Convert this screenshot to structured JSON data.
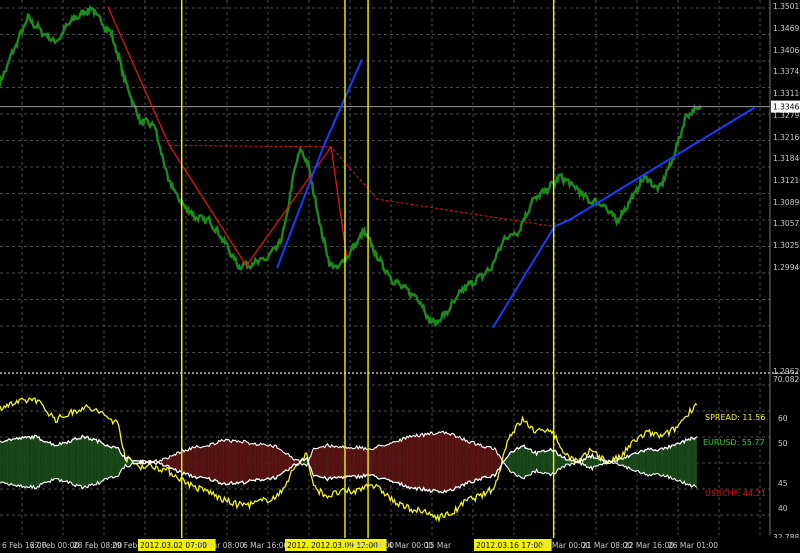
{
  "colors": {
    "background": "#000000",
    "grid": "#4a4a4a",
    "price": "#1d8a1d",
    "red_line": "#e01414",
    "blue_line": "#1a3cff",
    "yellow_marker": "#f4f400",
    "spread": "#f2f22a",
    "eurusd": "#ffffff",
    "green_fill": "#1a4a1a",
    "red_fill": "#5a1414",
    "label_text": "#c8c8c8",
    "separator": "#8a8a8a"
  },
  "chart_data": [
    {
      "type": "line",
      "name": "EURUSD price",
      "ylim": [
        1.2962,
        1.35015
      ],
      "y_ticks": [
        "1.35015",
        "1.34695",
        "1.34060",
        "1.33745",
        "1.33110",
        "1.32795",
        "1.32160",
        "1.31840",
        "1.31210",
        "1.30890",
        "1.30575",
        "1.30255",
        "1.29940",
        "1.29620"
      ],
      "current_price_label": "1.33465",
      "current_price": 1.33465,
      "x_labels": [
        "6 Feb 16:00",
        "27 Feb 00:00",
        "28 Feb 08:00",
        "29 Feb 16:00",
        "2012.03.02 07:00",
        "5 Mar 08:00",
        "6 Mar 16:00",
        "2012.03.08",
        "2012.03.09 12:00",
        "12 Mar 16:00",
        "14 Mar 00:00",
        "15 Mar",
        "2012.03.16 17:00",
        "20 Mar 00:00",
        "21 Mar 08:00",
        "22 Mar 16:00",
        "26 Mar 01:00"
      ],
      "x_highlighted_labels": [
        "2012.03.02 07:00",
        "2012.03.08",
        "2012.03.09 12:00",
        "2012.03.16 17:00"
      ],
      "price_anchors": [
        [
          0,
          1.338
        ],
        [
          0.02,
          1.343
        ],
        [
          0.04,
          1.3475
        ],
        [
          0.06,
          1.3455
        ],
        [
          0.08,
          1.344
        ],
        [
          0.1,
          1.347
        ],
        [
          0.13,
          1.349
        ],
        [
          0.16,
          1.345
        ],
        [
          0.18,
          1.338
        ],
        [
          0.2,
          1.3325
        ],
        [
          0.22,
          1.332
        ],
        [
          0.24,
          1.324
        ],
        [
          0.26,
          1.3205
        ],
        [
          0.28,
          1.3185
        ],
        [
          0.3,
          1.318
        ],
        [
          0.32,
          1.315
        ],
        [
          0.34,
          1.3115
        ],
        [
          0.36,
          1.3118
        ],
        [
          0.38,
          1.3125
        ],
        [
          0.4,
          1.3148
        ],
        [
          0.41,
          1.319
        ],
        [
          0.42,
          1.3255
        ],
        [
          0.43,
          1.3285
        ],
        [
          0.44,
          1.326
        ],
        [
          0.45,
          1.321
        ],
        [
          0.46,
          1.316
        ],
        [
          0.47,
          1.312
        ],
        [
          0.48,
          1.311
        ],
        [
          0.5,
          1.3135
        ],
        [
          0.52,
          1.3165
        ],
        [
          0.54,
          1.3125
        ],
        [
          0.56,
          1.3095
        ],
        [
          0.58,
          1.308
        ],
        [
          0.6,
          1.3065
        ],
        [
          0.61,
          1.304
        ],
        [
          0.62,
          1.303
        ],
        [
          0.64,
          1.305
        ],
        [
          0.66,
          1.308
        ],
        [
          0.68,
          1.3095
        ],
        [
          0.7,
          1.311
        ],
        [
          0.72,
          1.3155
        ],
        [
          0.74,
          1.3165
        ],
        [
          0.76,
          1.321
        ],
        [
          0.78,
          1.3225
        ],
        [
          0.8,
          1.3245
        ],
        [
          0.82,
          1.323
        ],
        [
          0.84,
          1.321
        ],
        [
          0.86,
          1.3205
        ],
        [
          0.88,
          1.318
        ],
        [
          0.9,
          1.321
        ],
        [
          0.92,
          1.3245
        ],
        [
          0.94,
          1.3225
        ],
        [
          0.96,
          1.327
        ],
        [
          0.98,
          1.3335
        ],
        [
          1.0,
          1.3345
        ]
      ],
      "zigzag_red": [
        [
          0.14,
          1.3492
        ],
        [
          0.22,
          1.329
        ],
        [
          0.32,
          1.3115
        ],
        [
          0.43,
          1.3288
        ],
        [
          0.45,
          1.313
        ]
      ],
      "zigzag_red_dashed": [
        [
          0.22,
          1.329
        ],
        [
          0.43,
          1.3288
        ],
        [
          0.49,
          1.3212
        ],
        [
          0.72,
          1.3172
        ]
      ],
      "blue_lines": [
        [
          [
            0.36,
            1.3112
          ],
          [
            0.42,
            1.3288
          ],
          [
            0.47,
            1.3415
          ]
        ],
        [
          [
            0.64,
            1.3025
          ],
          [
            0.72,
            1.3172
          ],
          [
            0.74,
            1.3182
          ],
          [
            0.98,
            1.3345
          ]
        ]
      ],
      "vertical_markers_fraction": [
        0.236,
        0.448,
        0.478,
        0.719
      ]
    },
    {
      "type": "area",
      "name": "Spread oscillator",
      "ylim": [
        32.7883,
        70.0828
      ],
      "y_ticks": [
        "70.0828",
        "60",
        "50",
        "45",
        "40",
        "32.7883"
      ],
      "legend": [
        {
          "name": "SPREAD: 11.56",
          "color": "#f2f22a"
        },
        {
          "name": "EURUSD: 55.77",
          "color": "#2ad02a"
        },
        {
          "name": "USDCHF: 44.21",
          "color": "#e01414"
        }
      ],
      "spread_anchors": [
        [
          0,
          63
        ],
        [
          0.05,
          65
        ],
        [
          0.08,
          60
        ],
        [
          0.12,
          63
        ],
        [
          0.14,
          62
        ],
        [
          0.17,
          59
        ],
        [
          0.18,
          51
        ],
        [
          0.2,
          49
        ],
        [
          0.22,
          49
        ],
        [
          0.24,
          48
        ],
        [
          0.26,
          46
        ],
        [
          0.28,
          44
        ],
        [
          0.3,
          43
        ],
        [
          0.32,
          41
        ],
        [
          0.34,
          40
        ],
        [
          0.36,
          40
        ],
        [
          0.38,
          41
        ],
        [
          0.4,
          42
        ],
        [
          0.42,
          48
        ],
        [
          0.44,
          52
        ],
        [
          0.45,
          44
        ],
        [
          0.47,
          42
        ],
        [
          0.49,
          43
        ],
        [
          0.51,
          43
        ],
        [
          0.53,
          45
        ],
        [
          0.55,
          43
        ],
        [
          0.57,
          40
        ],
        [
          0.59,
          39
        ],
        [
          0.61,
          38
        ],
        [
          0.63,
          37
        ],
        [
          0.65,
          38
        ],
        [
          0.67,
          41
        ],
        [
          0.69,
          42
        ],
        [
          0.71,
          44
        ],
        [
          0.73,
          56
        ],
        [
          0.75,
          60
        ],
        [
          0.77,
          57
        ],
        [
          0.79,
          58
        ],
        [
          0.81,
          52
        ],
        [
          0.83,
          50
        ],
        [
          0.85,
          53
        ],
        [
          0.87,
          50
        ],
        [
          0.89,
          51
        ],
        [
          0.91,
          55
        ],
        [
          0.93,
          57
        ],
        [
          0.95,
          56
        ],
        [
          0.97,
          58
        ],
        [
          0.99,
          62
        ],
        [
          1.0,
          64
        ]
      ],
      "eurusd_anchors": [
        [
          0,
          55
        ],
        [
          0.05,
          56
        ],
        [
          0.08,
          54
        ],
        [
          0.12,
          56
        ],
        [
          0.14,
          55
        ],
        [
          0.17,
          53
        ],
        [
          0.18,
          51
        ],
        [
          0.2,
          50
        ],
        [
          0.22,
          50
        ],
        [
          0.24,
          49
        ],
        [
          0.26,
          47.5
        ],
        [
          0.28,
          46.5
        ],
        [
          0.3,
          46
        ],
        [
          0.32,
          45
        ],
        [
          0.34,
          45
        ],
        [
          0.36,
          45.5
        ],
        [
          0.38,
          46
        ],
        [
          0.4,
          46.5
        ],
        [
          0.42,
          49
        ],
        [
          0.44,
          51
        ],
        [
          0.45,
          47
        ],
        [
          0.47,
          46
        ],
        [
          0.49,
          46.5
        ],
        [
          0.51,
          46.5
        ],
        [
          0.53,
          47
        ],
        [
          0.55,
          46
        ],
        [
          0.57,
          45
        ],
        [
          0.59,
          44
        ],
        [
          0.61,
          43.5
        ],
        [
          0.63,
          43
        ],
        [
          0.65,
          43.5
        ],
        [
          0.67,
          45
        ],
        [
          0.69,
          46
        ],
        [
          0.71,
          47
        ],
        [
          0.73,
          52
        ],
        [
          0.75,
          54
        ],
        [
          0.77,
          52
        ],
        [
          0.79,
          53
        ],
        [
          0.81,
          51
        ],
        [
          0.83,
          50
        ],
        [
          0.85,
          51.5
        ],
        [
          0.87,
          50
        ],
        [
          0.89,
          50.5
        ],
        [
          0.91,
          52
        ],
        [
          0.93,
          53
        ],
        [
          0.95,
          53
        ],
        [
          0.97,
          54
        ],
        [
          0.99,
          55.5
        ],
        [
          1.0,
          55.8
        ]
      ]
    }
  ]
}
